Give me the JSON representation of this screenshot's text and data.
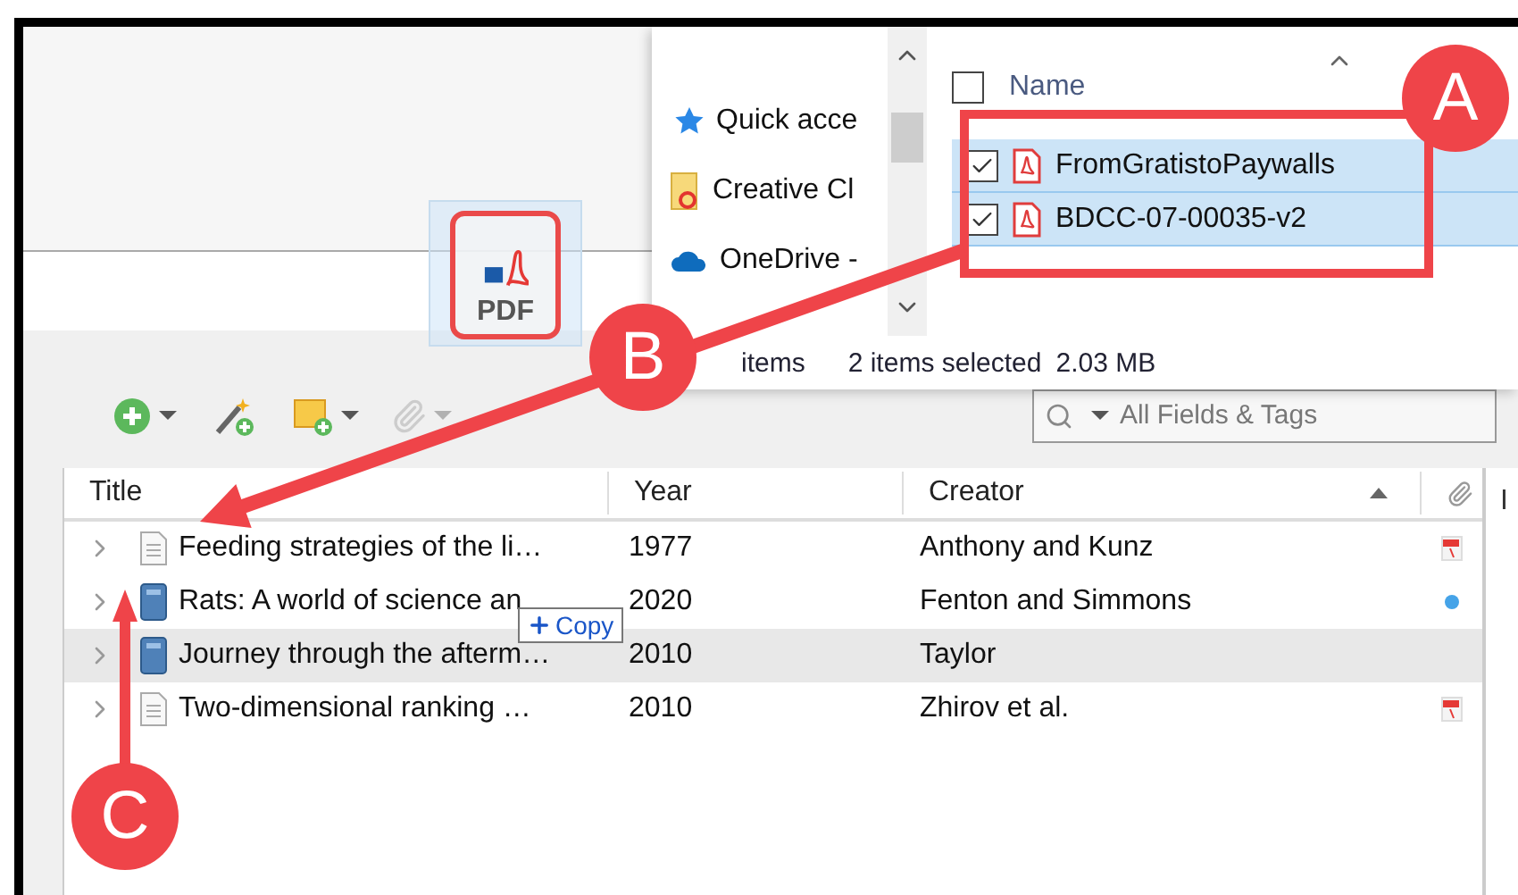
{
  "explorer": {
    "nav_items": [
      {
        "kind": "quick",
        "label": "Quick acce"
      },
      {
        "kind": "creative",
        "label": "Creative Cl"
      },
      {
        "kind": "cloud",
        "label": "OneDrive -"
      }
    ],
    "header": {
      "label": "Name",
      "checked": false
    },
    "files": [
      {
        "name": "FromGratistoPaywalls",
        "checked": true,
        "selected": true
      },
      {
        "name": "BDCC-07-00035-v2",
        "checked": true,
        "selected": true
      }
    ],
    "status": {
      "count": "items",
      "selection": "2 items selected",
      "size": "2.03 MB"
    }
  },
  "toolbar": {
    "search": {
      "placeholder": "All Fields & Tags"
    }
  },
  "table": {
    "columns": [
      {
        "label": "Title"
      },
      {
        "label": "Year"
      },
      {
        "label": "Creator"
      }
    ],
    "rows": [
      {
        "kind": "document",
        "title": "Feeding strategies of the li…",
        "year": "1977",
        "creator": "Anthony and Kunz",
        "attachment": {
          "kind": "pdf"
        },
        "selected": false
      },
      {
        "kind": "book",
        "title": "Rats: A world of science an",
        "year": "2020",
        "creator": "Fenton and Simmons",
        "attachment": {
          "kind": "link"
        },
        "selected": false
      },
      {
        "kind": "book",
        "title": "Journey through the afterm…",
        "year": "2010",
        "creator": "Taylor",
        "selected": true
      },
      {
        "kind": "document",
        "title": "Two-dimensional ranking …",
        "year": "2010",
        "creator": "Zhirov et al.",
        "attachment": {
          "kind": "pdf"
        },
        "selected": false
      }
    ]
  },
  "right_pane": {
    "text": "I"
  },
  "drag": {
    "file_type": "PDF",
    "action": "Copy"
  },
  "callouts": [
    {
      "label": "A"
    },
    {
      "label": "B"
    },
    {
      "label": "C"
    }
  ]
}
